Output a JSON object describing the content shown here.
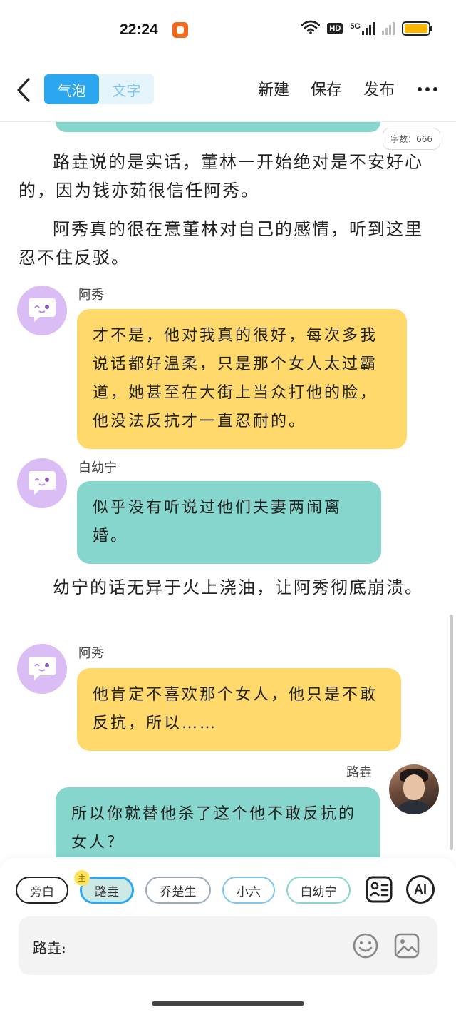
{
  "status_bar": {
    "time": "22:24",
    "icons": [
      "app-notification-icon",
      "wifi-icon",
      "hd-icon",
      "5g-signal-icon",
      "signal-icon",
      "battery-icon"
    ],
    "hd_label": "HD",
    "network_label": "5G",
    "battery_color": "#f7b500"
  },
  "toolbar": {
    "mode_tabs": [
      {
        "label": "气泡",
        "active": true
      },
      {
        "label": "文字",
        "active": false
      }
    ],
    "actions": {
      "new": "新建",
      "save": "保存",
      "publish": "发布"
    },
    "accent_color": "#2ba7f0"
  },
  "editor": {
    "word_count": "字数：666",
    "narration_1": "路垚说的是实话，董林一开始绝对是不安好心的，因为钱亦茹很信任阿秀。",
    "narration_2": "阿秀真的很在意董林对自己的感情，听到这里忍不住反驳。",
    "messages": [
      {
        "speaker": "阿秀",
        "text": "才不是，他对我真的很好，每次多我说话都好温柔，只是那个女人太过霸道，她甚至在大街上当众打他的脸，他没法反抗才一直忍耐的。",
        "color": "#ffd96b"
      },
      {
        "speaker": "白幼宁",
        "text": "似乎没有听说过他们夫妻两闹离婚。",
        "color": "#86d6cd"
      },
      {
        "speaker": "阿秀",
        "text": "他肯定不喜欢那个女人，他只是不敢反抗，所以……",
        "color": "#ffd96b"
      },
      {
        "speaker": "路垚",
        "text": "所以你就替他杀了这个他不敢反抗的女人？",
        "color": "#86d6cd"
      }
    ],
    "narration_3": "幼宁的话无异于火上浇油，让阿秀彻底崩溃。"
  },
  "character_bar": {
    "chips": [
      {
        "label": "旁白"
      },
      {
        "label": "路垚",
        "selected": true,
        "badge": "主"
      },
      {
        "label": "乔楚生"
      },
      {
        "label": "小六"
      },
      {
        "label": "白幼宁"
      }
    ],
    "ai_label": "AI"
  },
  "input": {
    "prefix": "路垚:"
  }
}
